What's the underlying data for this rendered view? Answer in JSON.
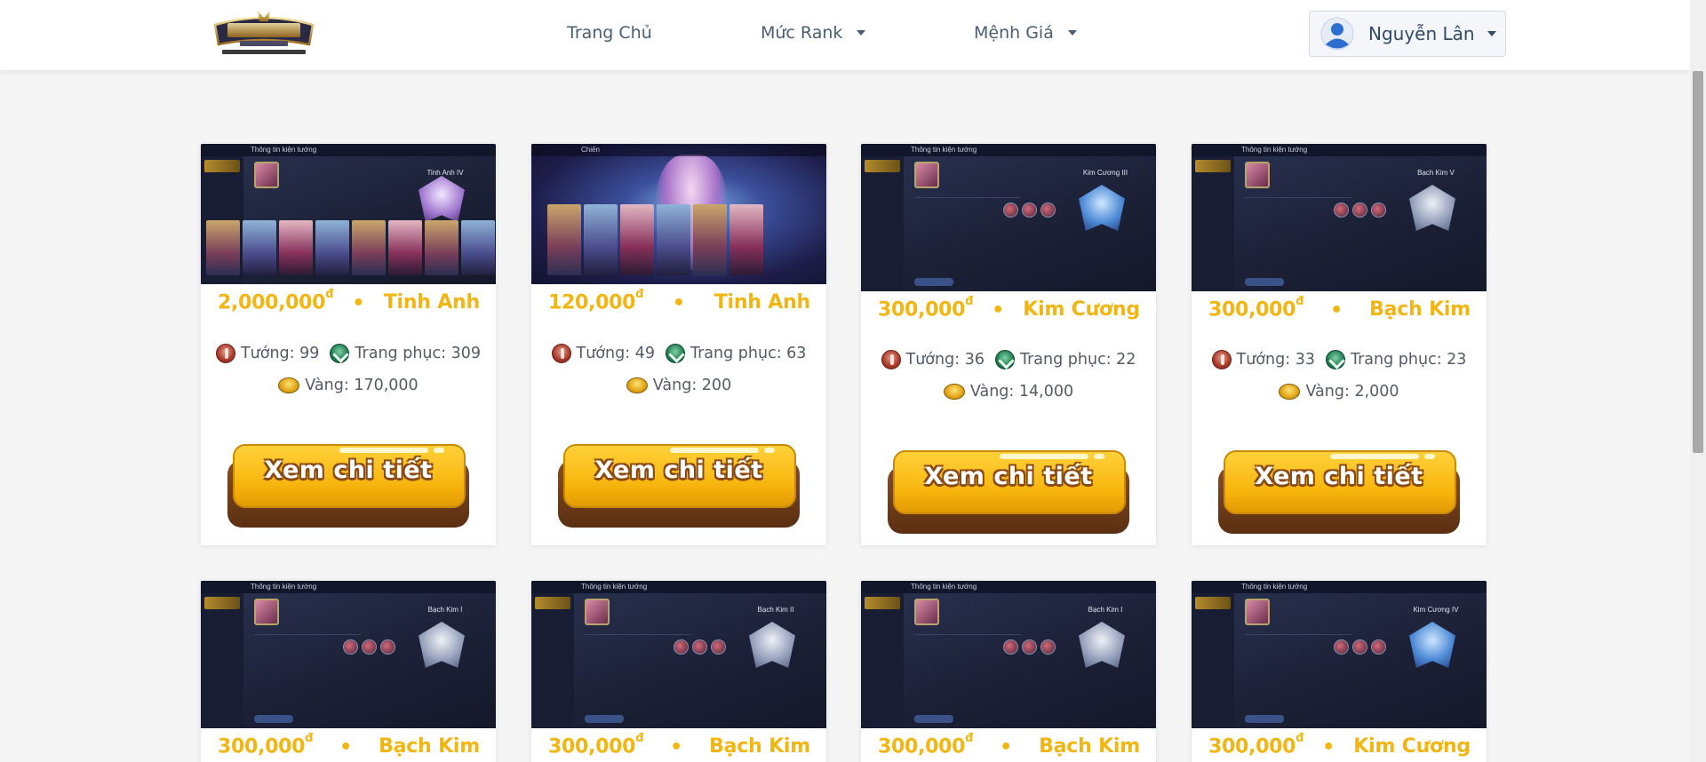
{
  "navbar": {
    "logo_text": "LIÊN QUÂN MOBILE · ARENA OF VALOR",
    "links": [
      {
        "label": "Trang Chủ"
      },
      {
        "label": "Mức Rank"
      },
      {
        "label": "Mệnh Giá"
      }
    ],
    "user": {
      "name": "Nguyễn Lân"
    }
  },
  "labels": {
    "heroes": "Tướng:",
    "skins": "Trang phục:",
    "gold": "Vàng:",
    "detail_button": "Xem chi tiết",
    "currency": "đ",
    "separator": "•"
  },
  "cards": [
    {
      "price": "2,000,000",
      "rank": "Tinh Anh",
      "heroes": "99",
      "skins": "309",
      "gold": "170,000",
      "image_rank": "Tinh Anh IV",
      "image_title": "Thông tin kiện tướng"
    },
    {
      "price": "120,000",
      "rank": "Tinh Anh",
      "heroes": "49",
      "skins": "63",
      "gold": "200",
      "image_rank": "",
      "image_title": "Chiến"
    },
    {
      "price": "300,000",
      "rank": "Kim Cương",
      "heroes": "36",
      "skins": "22",
      "gold": "14,000",
      "image_rank": "Kim Cương III",
      "image_title": "Thông tin kiện tướng"
    },
    {
      "price": "300,000",
      "rank": "Bạch Kim",
      "heroes": "33",
      "skins": "23",
      "gold": "2,000",
      "image_rank": "Bạch Kim V",
      "image_title": "Thông tin kiện tướng"
    },
    {
      "price": "300,000",
      "rank": "Bạch Kim",
      "image_rank": "Bạch Kim I",
      "image_title": "Thông tin kiện tướng"
    },
    {
      "price": "300,000",
      "rank": "Bạch Kim",
      "image_rank": "Bạch Kim II",
      "image_title": "Thông tin kiện tướng"
    },
    {
      "price": "300,000",
      "rank": "Bạch Kim",
      "image_rank": "Bạch Kim I",
      "image_title": "Thông tin kiện tướng"
    },
    {
      "price": "300,000",
      "rank": "Kim Cương",
      "image_rank": "Kim Cương IV",
      "image_title": "Thông tin kiện tướng"
    }
  ]
}
